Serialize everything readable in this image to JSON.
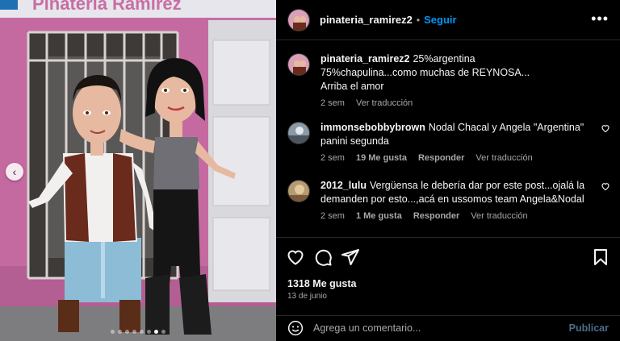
{
  "media": {
    "sign_text": "Pinatería Ramírez",
    "carousel_prev_glyph": "‹",
    "dots_total": 8,
    "dots_active_index": 6
  },
  "header": {
    "username": "pinateria_ramirez2",
    "separator": "•",
    "follow_label": "Seguir",
    "more_glyph": "•••"
  },
  "comments": [
    {
      "user": "pinateria_ramirez2",
      "lines": [
        "25%argentina",
        "75%chapulina...como muchas de REYNOSA...",
        "Arriba el amor"
      ],
      "time": "2 sem",
      "likes": "",
      "reply": "",
      "translate": "Ver traducción"
    },
    {
      "user": "immonsebobbybrown",
      "lines": [
        "Nodal Chacal y Angela \"Argentina\"",
        "panini segunda"
      ],
      "time": "2 sem",
      "likes": "19 Me gusta",
      "reply": "Responder",
      "translate": "Ver traducción"
    },
    {
      "user": "2012_lulu",
      "lines": [
        "Vergüensa le debería dar por este post...ojalá la",
        "demanden por esto...,acá en ussomos team Angela&Nodal"
      ],
      "time": "2 sem",
      "likes": "1 Me gusta",
      "reply": "Responder",
      "translate": "Ver traducción"
    }
  ],
  "post": {
    "likes": "1318 Me gusta",
    "date": "13 de junio"
  },
  "composer": {
    "placeholder": "Agrega un comentario...",
    "publish_label": "Publicar"
  },
  "icons": {
    "like": "heart-icon",
    "comment": "comment-icon",
    "share": "share-icon",
    "save": "bookmark-icon",
    "emoji": "emoji-icon"
  },
  "colors": {
    "background": "#000000",
    "accent": "#0095f6",
    "muted": "#a8a8a8",
    "publish_disabled": "#4a6c89",
    "wall_pink": "#c96aa0"
  }
}
